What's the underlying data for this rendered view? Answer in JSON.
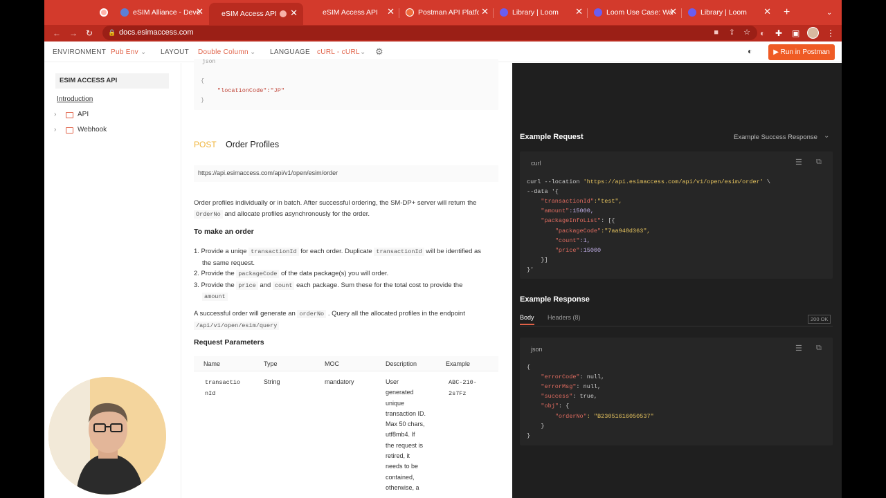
{
  "browser": {
    "tabs": [
      {
        "label": "",
        "icon": "record-icon"
      },
      {
        "label": "eSIM Alliance - Deve",
        "icon": "globe-icon"
      },
      {
        "label": "eSIM Access API",
        "icon": "record-icon"
      },
      {
        "label": "eSIM Access API",
        "icon": ""
      },
      {
        "label": "Postman API Platform",
        "icon": "postman-icon"
      },
      {
        "label": "Library | Loom",
        "icon": "loom-icon"
      },
      {
        "label": "Loom Use Case: Wa",
        "icon": "loom-icon"
      },
      {
        "label": "Library | Loom",
        "icon": "loom-icon"
      }
    ],
    "url": "docs.esimaccess.com"
  },
  "topnav": {
    "environment_label": "ENVIRONMENT",
    "environment_value": "Pub Env",
    "layout_label": "LAYOUT",
    "layout_value": "Double Column",
    "language_label": "LANGUAGE",
    "language_value": "cURL - cURL",
    "run_button": "Run in Postman"
  },
  "sidebar": {
    "title": "ESIM ACCESS API",
    "intro": "Introduction",
    "items": [
      {
        "label": "API"
      },
      {
        "label": "Webhook"
      }
    ]
  },
  "content": {
    "prev_code_label": "json",
    "prev_code_lines": [
      "{",
      "\"locationCode\":\"JP\"",
      "}"
    ],
    "method": "POST",
    "endpoint_title": "Order Profiles",
    "endpoint_url": "https://api.esimaccess.com/api/v1/open/esim/order",
    "desc_1": "Order profiles individually or in batch. After successful ordering, the SM-DP+ server will return the",
    "desc_code": "OrderNo",
    "desc_2": "and allocate profiles asynchronously for the order.",
    "make_order_heading": "To make an order",
    "step1_a": "1. Provide a uniqe",
    "step1_code1": "transactionId",
    "step1_b": "for each order. Duplicate",
    "step1_code2": "transactionId",
    "step1_c": "will be identified as",
    "step1_d": "the same request.",
    "step2_a": "2. Provide the",
    "step2_code": "packageCode",
    "step2_b": "of the data package(s) you will order.",
    "step3_a": "3. Provide the",
    "step3_code1": "price",
    "step3_and": "and",
    "step3_code2": "count",
    "step3_b": "each package. Sum these for the total cost to provide the",
    "step3_code3": "amount",
    "success_a": "A successful order will generate an",
    "success_code": "orderNo",
    "success_b": ". Query all the allocated profiles in the endpoint",
    "success_path": "/api/v1/open/esim/query",
    "params_heading": "Request Parameters",
    "table_headers": [
      "Name",
      "Type",
      "MOC",
      "Description",
      "Example"
    ],
    "row": {
      "name": [
        "transactio",
        "nId"
      ],
      "type": "String",
      "moc": "mandatory",
      "description": [
        "User",
        "generated",
        "unique",
        "transaction ID.",
        "Max 50 chars,",
        "utf8mb4. If",
        "the request is",
        "retired, it",
        "needs to be",
        "contained,",
        "otherwise, a"
      ],
      "example": [
        "ABC-210-",
        "2s7Fz"
      ]
    }
  },
  "right": {
    "example_request": "Example Request",
    "success_dropdown": "Example Success Response",
    "req_lang": "curl",
    "req_lines": [
      {
        "t": "curl --location ",
        "s": "'https://api.esimaccess.com/api/v1/open/esim/order'",
        "e": " \\"
      },
      {
        "t": "--data '{",
        "s": "",
        "e": ""
      },
      {
        "t": "    ",
        "k": "\"transactionId\"",
        "v": ":\"test\","
      },
      {
        "t": "    ",
        "k": "\"amount\"",
        "v": ":15000,"
      },
      {
        "t": "    ",
        "k": "\"packageInfoList\"",
        "v": ": [{"
      },
      {
        "t": "        ",
        "k": "\"packageCode\"",
        "v": ":\"7aa948d363\","
      },
      {
        "t": "        ",
        "k": "\"count\"",
        "v": ":1,"
      },
      {
        "t": "        ",
        "k": "\"price\"",
        "v": ":15000"
      },
      {
        "t": "    }]",
        "k": "",
        "v": ""
      },
      {
        "t": "}'",
        "k": "",
        "v": ""
      }
    ],
    "example_response": "Example Response",
    "tab_body": "Body",
    "tab_headers": "Headers (8)",
    "status": "200 OK",
    "resp_lang": "json",
    "resp_lines": [
      {
        "t": "{",
        "k": "",
        "v": ""
      },
      {
        "t": "    ",
        "k": "\"errorCode\"",
        "v": ": null,"
      },
      {
        "t": "    ",
        "k": "\"errorMsg\"",
        "v": ": null,"
      },
      {
        "t": "    ",
        "k": "\"success\"",
        "v": ": true,"
      },
      {
        "t": "    ",
        "k": "\"obj\"",
        "v": ": {"
      },
      {
        "t": "        ",
        "k": "\"orderNo\"",
        "v": ": \"B23051616050537\""
      },
      {
        "t": "    }",
        "k": "",
        "v": ""
      },
      {
        "t": "}",
        "k": "",
        "v": ""
      }
    ]
  }
}
